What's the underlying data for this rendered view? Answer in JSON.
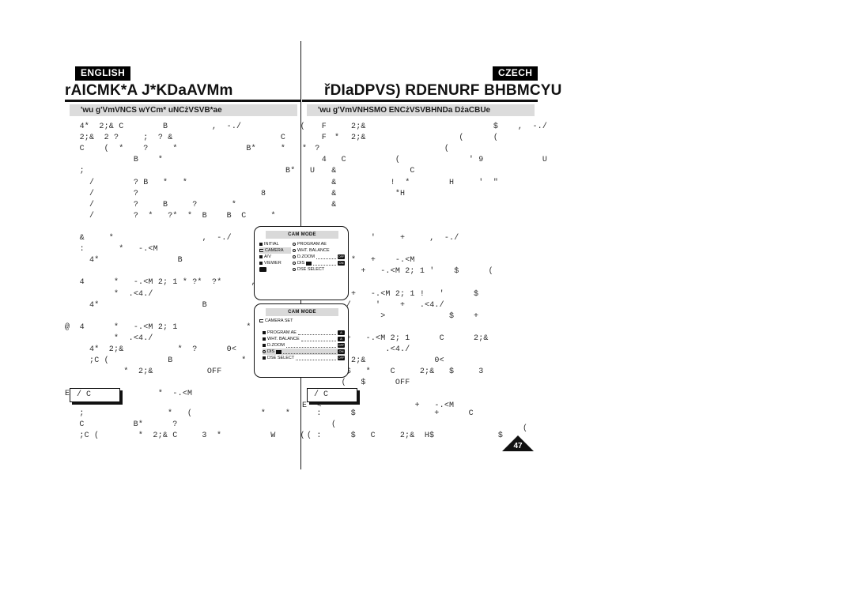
{
  "page": {
    "number": "47",
    "corner_mark": "(",
    "divider": "vertical-center-rule"
  },
  "columns": {
    "english": {
      "lang_tag": "ENGLISH",
      "chapter_title": "rAICMK*A J*KDaAVMm",
      "section_heading": "'wu g'VmVNCS wYCm* uNCżVSVB*ae",
      "body_lines": [
        "   4*  2;& C        B         ,  -./            (",
        "   2;&  2 ?     ;  ? &                      C          *",
        "   C    (  *    ?     *              B*     *      ?",
        "              B    *",
        "   ;                                         B*   U",
        "     /        ? B   *   *",
        "     /        ?                         8",
        "     /        ?     B     ?       *",
        "     /        ?  *   ?*  *  B    B  C     *",
        "",
        "   &     *                  ,  -./",
        "   :       *   -.<M",
        "     4*                B",
        "",
        "   4      *   -.<M 2; 1 * ?*  ?*      ,  -./",
        "          *  .<4./",
        "     4*                     B",
        "",
        "@  4      *   -.<M 2; 1              *   2;&",
        "          *  .<4./",
        "     4*  2;&           *  ?      0<",
        "     ;C (            B              *  2;& C",
        "            *  2;&           OFF",
        "",
        "E  4   D  3        *  -.<M"
      ],
      "note": {
        "label": "/ C",
        "lines": [
          "  ;                 *   (              *    *",
          "  C          B*      ?",
          "  ;C (        *  2;& C     3  *          W     ("
        ]
      }
    },
    "czech": {
      "lang_tag": "CZECH",
      "chapter_title": "řDIaDPVS) RDENURF BHBMCYU",
      "section_heading": "'wu g'VmVNHSMO ENCżVSVBHNDa DżaCBUe",
      "body_lines": [
        "    F     2;&                          $    ,  -./",
        "    F     2;&                   (      (",
        "*                            (",
        "    4   C          (              ' 9            U",
        "      &               C",
        "      &           !  *        H     '  \"",
        "      &            *H",
        "      &",
        "",
        "",
        "    #         '     +     ,  -./",
        "",
        "    &     *   +    -.<M",
        "    >       +   -.<M 2; 1 '    $      (",
        "",
        "    0     +   -.<M 2; 1 !   '      $",
        "    ,  -./     '    +   .<4./",
        "                >             $    +",
        "",
        "@  0     +   -.<M 2; 1      C      2;&",
        "        +        .<4./",
        "    <     2;&              0<",
        "    ?    $   *    C     2;&   $     3",
        "        (   $      OFF",
        "",
        "E  <                   +   -.<M"
      ],
      "note": {
        "label": "/ C",
        "lines": [
          "  :      $                +      C",
          "     (",
          "( :      $   C     2;&  H$             $"
        ]
      }
    }
  },
  "lcd_screens": [
    {
      "id": "cam-mode-main",
      "title": "CAM MODE",
      "left_menu": [
        {
          "label": "INITIAL",
          "marker": "square",
          "selected": false
        },
        {
          "label": "CAMERA",
          "marker": "folder",
          "selected": true
        },
        {
          "label": "A/V",
          "marker": "square",
          "selected": false
        },
        {
          "label": "VIEWER",
          "marker": "square",
          "selected": false
        },
        {
          "label": "",
          "marker": "badge",
          "selected": false
        }
      ],
      "right_menu": [
        {
          "label": "PROGRAM AE",
          "marker": "circle",
          "dots": false,
          "badge": ""
        },
        {
          "label": "WHT. BALANCE",
          "marker": "circle",
          "dots": false,
          "badge": ""
        },
        {
          "label": "D.ZOOM",
          "marker": "circle",
          "dots": true,
          "badge": "OFF"
        },
        {
          "label": "DIS",
          "marker": "circle",
          "dots": true,
          "badge": "ON",
          "icon": true
        },
        {
          "label": "DSE SELECT",
          "marker": "circle",
          "dots": false,
          "badge": ""
        }
      ]
    },
    {
      "id": "camera-set",
      "title": "CAM MODE",
      "submenu_label": "CAMERA SET",
      "items": [
        {
          "label": "PROGRAM AE",
          "marker": "square",
          "dots": true,
          "badge": "A",
          "highlighted": false,
          "icon": false
        },
        {
          "label": "WHT. BALANCE",
          "marker": "square",
          "dots": true,
          "badge": "A",
          "highlighted": false,
          "icon": false
        },
        {
          "label": "D.ZOOM",
          "marker": "square",
          "dots": true,
          "badge": "OFF",
          "highlighted": false,
          "icon": false
        },
        {
          "label": "DIS",
          "marker": "circle",
          "dots": true,
          "badge": "ON",
          "highlighted": true,
          "icon": true
        },
        {
          "label": "DSE SELECT",
          "marker": "square",
          "dots": true,
          "badge": "OFF",
          "highlighted": false,
          "icon": false
        }
      ]
    }
  ],
  "colors": {
    "ink": "#111111",
    "grey_band": "#dcdcdc",
    "lcd_highlight": "#d9d9d9",
    "paper": "#ffffff"
  }
}
